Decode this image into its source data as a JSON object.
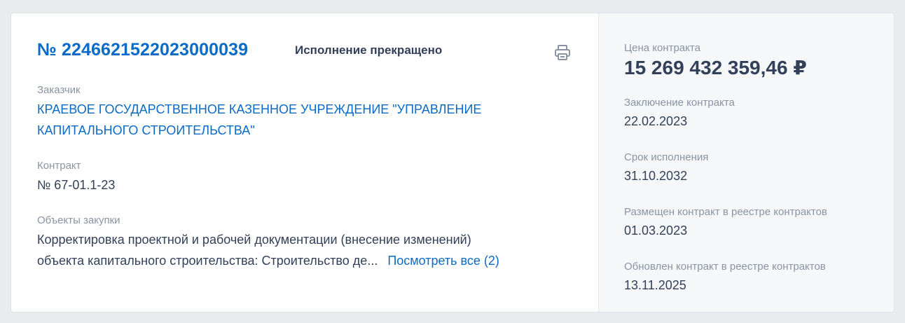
{
  "contract": {
    "number": "№ 2246621522023000039",
    "status": "Исполнение прекращено",
    "print_icon": "printer-icon"
  },
  "customer": {
    "label": "Заказчик",
    "name_line1": "КРАЕВОЕ ГОСУДАРСТВЕННОЕ КАЗЕННОЕ УЧРЕЖДЕНИЕ \"УПРАВЛЕНИЕ",
    "name_line2": "КАПИТАЛЬНОГО СТРОИТЕЛЬСТВА\""
  },
  "contract_doc": {
    "label": "Контракт",
    "value": "№ 67-01.1-23"
  },
  "objects": {
    "label": "Объекты закупки",
    "line1": "Корректировка проектной и рабочей документации (внесение изменений)",
    "line2": "объекта капитального строительства: Строительство де...",
    "more_link": "Посмотреть все (2)"
  },
  "summary": {
    "price_label": "Цена контракта",
    "price_value": "15 269 432 359,46 ₽",
    "conclusion_label": "Заключение контракта",
    "conclusion_value": "22.02.2023",
    "term_label": "Срок исполнения",
    "term_value": "31.10.2032",
    "posted_label": "Размещен контракт в реестре контрактов",
    "posted_value": "01.03.2023",
    "updated_label": "Обновлен контракт в реестре контрактов",
    "updated_value": "13.11.2025"
  },
  "colors": {
    "accent": "#0b6bc7",
    "text": "#334059",
    "muted": "#8a94a4"
  }
}
